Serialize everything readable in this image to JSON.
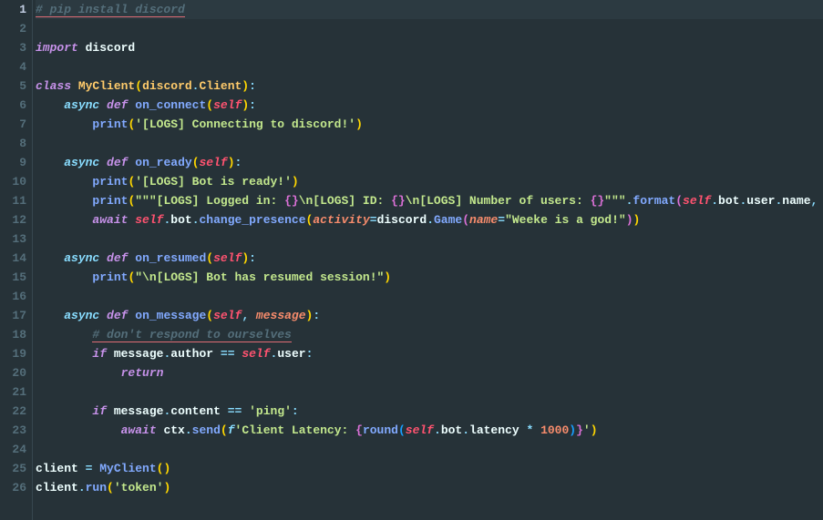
{
  "lines": [
    {
      "num": "1",
      "active": true,
      "segments": [
        {
          "cls": "comment underline",
          "text": "# pip install discord"
        }
      ]
    },
    {
      "num": "2",
      "segments": []
    },
    {
      "num": "3",
      "segments": [
        {
          "cls": "keyword",
          "text": "import"
        },
        {
          "cls": "default",
          "text": " discord"
        }
      ]
    },
    {
      "num": "4",
      "segments": []
    },
    {
      "num": "5",
      "segments": [
        {
          "cls": "keyword",
          "text": "class"
        },
        {
          "cls": "default",
          "text": " "
        },
        {
          "cls": "classname",
          "text": "MyClient"
        },
        {
          "cls": "paren",
          "text": "("
        },
        {
          "cls": "classname",
          "text": "discord"
        },
        {
          "cls": "operator",
          "text": "."
        },
        {
          "cls": "classname",
          "text": "Client"
        },
        {
          "cls": "paren",
          "text": ")"
        },
        {
          "cls": "operator",
          "text": ":"
        }
      ]
    },
    {
      "num": "6",
      "segments": [
        {
          "cls": "default",
          "text": "    "
        },
        {
          "cls": "keyword2",
          "text": "async"
        },
        {
          "cls": "default",
          "text": " "
        },
        {
          "cls": "keyword",
          "text": "def"
        },
        {
          "cls": "default",
          "text": " "
        },
        {
          "cls": "funcname",
          "text": "on_connect"
        },
        {
          "cls": "paren",
          "text": "("
        },
        {
          "cls": "self",
          "text": "self"
        },
        {
          "cls": "paren",
          "text": ")"
        },
        {
          "cls": "operator",
          "text": ":"
        }
      ]
    },
    {
      "num": "7",
      "segments": [
        {
          "cls": "default",
          "text": "        "
        },
        {
          "cls": "funcname",
          "text": "print"
        },
        {
          "cls": "paren",
          "text": "("
        },
        {
          "cls": "string",
          "text": "'[LOGS] Connecting to discord!'"
        },
        {
          "cls": "paren",
          "text": ")"
        }
      ]
    },
    {
      "num": "8",
      "segments": []
    },
    {
      "num": "9",
      "segments": [
        {
          "cls": "default",
          "text": "    "
        },
        {
          "cls": "keyword2",
          "text": "async"
        },
        {
          "cls": "default",
          "text": " "
        },
        {
          "cls": "keyword",
          "text": "def"
        },
        {
          "cls": "default",
          "text": " "
        },
        {
          "cls": "funcname",
          "text": "on_ready"
        },
        {
          "cls": "paren",
          "text": "("
        },
        {
          "cls": "self",
          "text": "self"
        },
        {
          "cls": "paren",
          "text": ")"
        },
        {
          "cls": "operator",
          "text": ":"
        }
      ]
    },
    {
      "num": "10",
      "segments": [
        {
          "cls": "default",
          "text": "        "
        },
        {
          "cls": "funcname",
          "text": "print"
        },
        {
          "cls": "paren",
          "text": "("
        },
        {
          "cls": "string",
          "text": "'[LOGS] Bot is ready!'"
        },
        {
          "cls": "paren",
          "text": ")"
        }
      ]
    },
    {
      "num": "11",
      "segments": [
        {
          "cls": "default",
          "text": "        "
        },
        {
          "cls": "funcname",
          "text": "print"
        },
        {
          "cls": "paren",
          "text": "("
        },
        {
          "cls": "string",
          "text": "\"\"\"[LOGS] Logged in: "
        },
        {
          "cls": "paren2",
          "text": "{}"
        },
        {
          "cls": "string",
          "text": "\\n[LOGS] ID: "
        },
        {
          "cls": "paren2",
          "text": "{}"
        },
        {
          "cls": "string",
          "text": "\\n[LOGS] Number of users: "
        },
        {
          "cls": "paren2",
          "text": "{}"
        },
        {
          "cls": "string",
          "text": "\"\"\""
        },
        {
          "cls": "operator",
          "text": "."
        },
        {
          "cls": "funcname",
          "text": "format"
        },
        {
          "cls": "paren2",
          "text": "("
        },
        {
          "cls": "self",
          "text": "self"
        },
        {
          "cls": "operator",
          "text": "."
        },
        {
          "cls": "property",
          "text": "bot"
        },
        {
          "cls": "operator",
          "text": "."
        },
        {
          "cls": "property",
          "text": "user"
        },
        {
          "cls": "operator",
          "text": "."
        },
        {
          "cls": "property",
          "text": "name"
        },
        {
          "cls": "operator",
          "text": ", "
        },
        {
          "cls": "property",
          "text": "s"
        }
      ]
    },
    {
      "num": "12",
      "segments": [
        {
          "cls": "default",
          "text": "        "
        },
        {
          "cls": "keyword",
          "text": "await"
        },
        {
          "cls": "default",
          "text": " "
        },
        {
          "cls": "self",
          "text": "self"
        },
        {
          "cls": "operator",
          "text": "."
        },
        {
          "cls": "property",
          "text": "bot"
        },
        {
          "cls": "operator",
          "text": "."
        },
        {
          "cls": "funcname",
          "text": "change_presence"
        },
        {
          "cls": "paren",
          "text": "("
        },
        {
          "cls": "param",
          "text": "activity"
        },
        {
          "cls": "operator",
          "text": "="
        },
        {
          "cls": "property",
          "text": "discord"
        },
        {
          "cls": "operator",
          "text": "."
        },
        {
          "cls": "funcname",
          "text": "Game"
        },
        {
          "cls": "paren2",
          "text": "("
        },
        {
          "cls": "param",
          "text": "name"
        },
        {
          "cls": "operator",
          "text": "="
        },
        {
          "cls": "string",
          "text": "\"Weeke is a god!\""
        },
        {
          "cls": "paren2",
          "text": ")"
        },
        {
          "cls": "paren",
          "text": ")"
        }
      ]
    },
    {
      "num": "13",
      "segments": []
    },
    {
      "num": "14",
      "segments": [
        {
          "cls": "default",
          "text": "    "
        },
        {
          "cls": "keyword2",
          "text": "async"
        },
        {
          "cls": "default",
          "text": " "
        },
        {
          "cls": "keyword",
          "text": "def"
        },
        {
          "cls": "default",
          "text": " "
        },
        {
          "cls": "funcname",
          "text": "on_resumed"
        },
        {
          "cls": "paren",
          "text": "("
        },
        {
          "cls": "self",
          "text": "self"
        },
        {
          "cls": "paren",
          "text": ")"
        },
        {
          "cls": "operator",
          "text": ":"
        }
      ]
    },
    {
      "num": "15",
      "segments": [
        {
          "cls": "default",
          "text": "        "
        },
        {
          "cls": "funcname",
          "text": "print"
        },
        {
          "cls": "paren",
          "text": "("
        },
        {
          "cls": "string",
          "text": "\"\\n[LOGS] Bot has resumed session!\""
        },
        {
          "cls": "paren",
          "text": ")"
        }
      ]
    },
    {
      "num": "16",
      "segments": []
    },
    {
      "num": "17",
      "segments": [
        {
          "cls": "default",
          "text": "    "
        },
        {
          "cls": "keyword2",
          "text": "async"
        },
        {
          "cls": "default",
          "text": " "
        },
        {
          "cls": "keyword",
          "text": "def"
        },
        {
          "cls": "default",
          "text": " "
        },
        {
          "cls": "funcname",
          "text": "on_message"
        },
        {
          "cls": "paren",
          "text": "("
        },
        {
          "cls": "self",
          "text": "self"
        },
        {
          "cls": "operator",
          "text": ", "
        },
        {
          "cls": "param",
          "text": "message"
        },
        {
          "cls": "paren",
          "text": ")"
        },
        {
          "cls": "operator",
          "text": ":"
        }
      ]
    },
    {
      "num": "18",
      "segments": [
        {
          "cls": "default",
          "text": "        "
        },
        {
          "cls": "comment underline",
          "text": "# don't respond to ourselves"
        }
      ]
    },
    {
      "num": "19",
      "segments": [
        {
          "cls": "default",
          "text": "        "
        },
        {
          "cls": "keyword",
          "text": "if"
        },
        {
          "cls": "default",
          "text": " message"
        },
        {
          "cls": "operator",
          "text": "."
        },
        {
          "cls": "property",
          "text": "author"
        },
        {
          "cls": "default",
          "text": " "
        },
        {
          "cls": "operator",
          "text": "=="
        },
        {
          "cls": "default",
          "text": " "
        },
        {
          "cls": "self",
          "text": "self"
        },
        {
          "cls": "operator",
          "text": "."
        },
        {
          "cls": "property",
          "text": "user"
        },
        {
          "cls": "operator",
          "text": ":"
        }
      ]
    },
    {
      "num": "20",
      "segments": [
        {
          "cls": "default",
          "text": "            "
        },
        {
          "cls": "keyword",
          "text": "return"
        }
      ]
    },
    {
      "num": "21",
      "segments": []
    },
    {
      "num": "22",
      "segments": [
        {
          "cls": "default",
          "text": "        "
        },
        {
          "cls": "keyword",
          "text": "if"
        },
        {
          "cls": "default",
          "text": " message"
        },
        {
          "cls": "operator",
          "text": "."
        },
        {
          "cls": "property",
          "text": "content"
        },
        {
          "cls": "default",
          "text": " "
        },
        {
          "cls": "operator",
          "text": "=="
        },
        {
          "cls": "default",
          "text": " "
        },
        {
          "cls": "string",
          "text": "'ping'"
        },
        {
          "cls": "operator",
          "text": ":"
        }
      ]
    },
    {
      "num": "23",
      "segments": [
        {
          "cls": "default",
          "text": "            "
        },
        {
          "cls": "keyword",
          "text": "await"
        },
        {
          "cls": "default",
          "text": " ctx"
        },
        {
          "cls": "operator",
          "text": "."
        },
        {
          "cls": "funcname",
          "text": "send"
        },
        {
          "cls": "paren",
          "text": "("
        },
        {
          "cls": "keyword2",
          "text": "f"
        },
        {
          "cls": "string",
          "text": "'Client Latency: "
        },
        {
          "cls": "paren2",
          "text": "{"
        },
        {
          "cls": "funcname",
          "text": "round"
        },
        {
          "cls": "paren3",
          "text": "("
        },
        {
          "cls": "self",
          "text": "self"
        },
        {
          "cls": "operator",
          "text": "."
        },
        {
          "cls": "property",
          "text": "bot"
        },
        {
          "cls": "operator",
          "text": "."
        },
        {
          "cls": "property",
          "text": "latency"
        },
        {
          "cls": "default",
          "text": " "
        },
        {
          "cls": "operator",
          "text": "*"
        },
        {
          "cls": "default",
          "text": " "
        },
        {
          "cls": "number",
          "text": "1000"
        },
        {
          "cls": "paren3",
          "text": ")"
        },
        {
          "cls": "paren2",
          "text": "}"
        },
        {
          "cls": "string",
          "text": "'"
        },
        {
          "cls": "paren",
          "text": ")"
        }
      ]
    },
    {
      "num": "24",
      "segments": []
    },
    {
      "num": "25",
      "segments": [
        {
          "cls": "default",
          "text": "client "
        },
        {
          "cls": "operator",
          "text": "="
        },
        {
          "cls": "default",
          "text": " "
        },
        {
          "cls": "funcname",
          "text": "MyClient"
        },
        {
          "cls": "paren",
          "text": "()"
        }
      ]
    },
    {
      "num": "26",
      "segments": [
        {
          "cls": "default",
          "text": "client"
        },
        {
          "cls": "operator",
          "text": "."
        },
        {
          "cls": "funcname",
          "text": "run"
        },
        {
          "cls": "paren",
          "text": "("
        },
        {
          "cls": "string",
          "text": "'token'"
        },
        {
          "cls": "paren",
          "text": ")"
        }
      ]
    }
  ]
}
